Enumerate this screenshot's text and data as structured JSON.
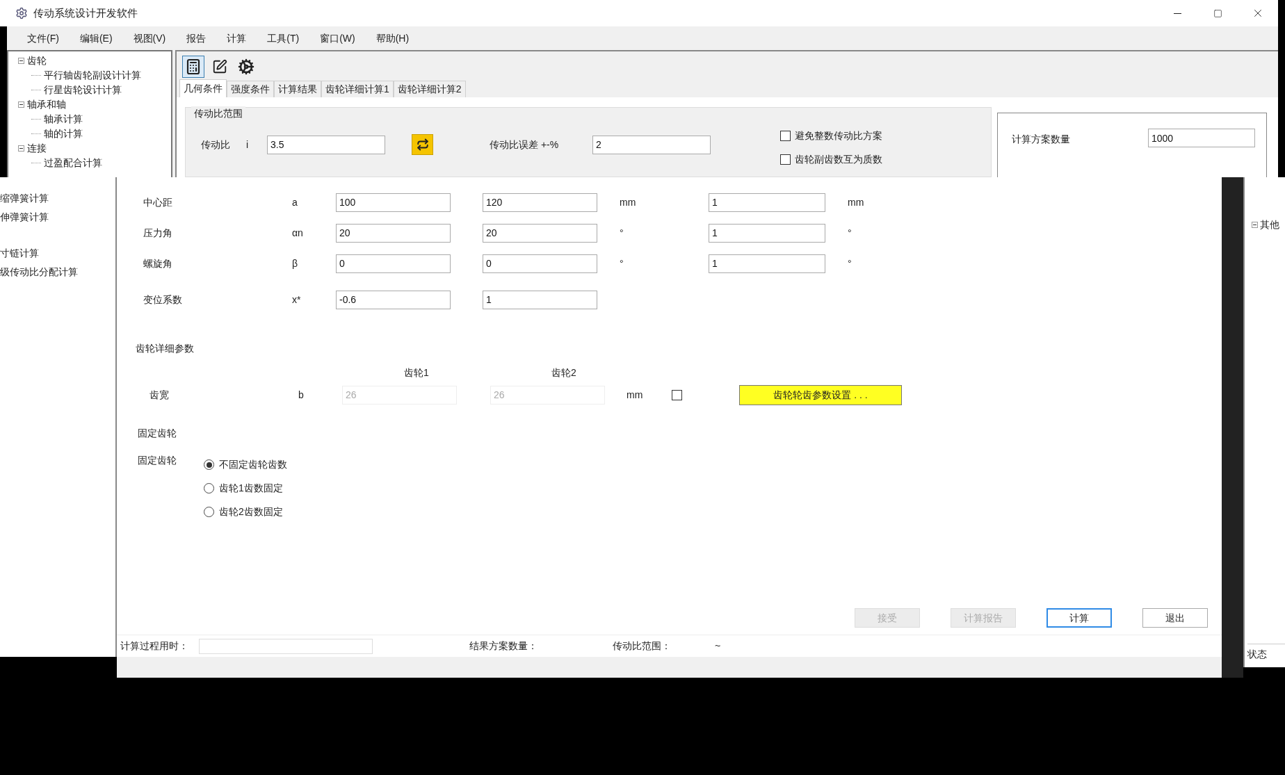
{
  "window": {
    "title": "传动系统设计开发软件"
  },
  "menu": [
    "文件(F)",
    "编辑(E)",
    "视图(V)",
    "报告",
    "计算",
    "工具(T)",
    "窗口(W)",
    "帮助(H)"
  ],
  "tree": [
    {
      "label": "齿轮",
      "expanded": true,
      "children": [
        {
          "label": "平行轴齿轮副设计计算"
        },
        {
          "label": "行星齿轮设计计算"
        }
      ]
    },
    {
      "label": "轴承和轴",
      "expanded": true,
      "children": [
        {
          "label": "轴承计算"
        },
        {
          "label": "轴的计算"
        }
      ]
    },
    {
      "label": "连接",
      "expanded": true,
      "children": [
        {
          "label": "过盈配合计算"
        }
      ]
    }
  ],
  "toolbar": [
    {
      "kind": "calculator",
      "selected": true
    },
    {
      "kind": "note",
      "selected": false
    },
    {
      "kind": "gear",
      "selected": false
    }
  ],
  "tabs": [
    {
      "label": "几何条件",
      "selected": true
    },
    {
      "label": "强度条件",
      "selected": false
    },
    {
      "label": "计算结果",
      "selected": false
    },
    {
      "label": "齿轮详细计算1",
      "selected": false
    },
    {
      "label": "齿轮详细计算2",
      "selected": false
    }
  ],
  "ratio_group": {
    "title": "传动比范围",
    "ratio_label": "传动比",
    "ratio_symbol": "i",
    "ratio_value": "3.5",
    "error_label": "传动比误差 +-%",
    "error_value": "2",
    "options": [
      {
        "label": "避免整数传动比方案",
        "checked": false
      },
      {
        "label": "齿轮副齿数互为质数",
        "checked": false
      }
    ]
  },
  "scheme_count": {
    "label": "计算方案数量",
    "value": "1000"
  },
  "left_fragment": [
    "缩弹簧计算",
    "伸弹簧计算",
    "寸链计算",
    "级传动比分配计算"
  ],
  "params": [
    {
      "label": "中心距",
      "symbol": "a",
      "value_1": "100",
      "value_2": "120",
      "unit_1": "mm",
      "value_3": "1",
      "unit_2": "mm"
    },
    {
      "label": "压力角",
      "symbol": "αn",
      "value_1": "20",
      "value_2": "20",
      "unit_1": "°",
      "value_3": "1",
      "unit_2": "°"
    },
    {
      "label": "螺旋角",
      "symbol": "β",
      "value_1": "0",
      "value_2": "0",
      "unit_1": "°",
      "value_3": "1",
      "unit_2": "°"
    },
    {
      "label": "变位系数",
      "symbol": "x*",
      "value_1": "-0.6",
      "value_2": "1"
    }
  ],
  "detail": {
    "title": "齿轮详细参数",
    "columns": [
      "齿轮1",
      "齿轮2"
    ],
    "label": "齿宽",
    "symbol": "b",
    "values": [
      "26",
      "26"
    ],
    "disabled": true,
    "unit": "mm",
    "checked": false,
    "settings_button": "齿轮轮齿参数设置 . . ."
  },
  "fixed_gear": {
    "title": "固定齿轮",
    "label": "固定齿轮",
    "options": [
      {
        "label": "不固定齿轮齿数",
        "selected": true
      },
      {
        "label": "齿轮1齿数固定",
        "selected": false
      },
      {
        "label": "齿轮2齿数固定",
        "selected": false
      }
    ]
  },
  "buttons": [
    {
      "label": "接受",
      "disabled": true,
      "focused": false
    },
    {
      "label": "计算报告",
      "disabled": true,
      "focused": false
    },
    {
      "label": "计算",
      "disabled": false,
      "focused": true
    },
    {
      "label": "退出",
      "disabled": false,
      "focused": false
    }
  ],
  "status": {
    "time_label": "计算过程用时：",
    "count_label": "结果方案数量：",
    "range_label": "传动比范围：",
    "range_value": "~"
  },
  "right_fragment": {
    "tree_item": "其他",
    "status_label": "状态"
  }
}
